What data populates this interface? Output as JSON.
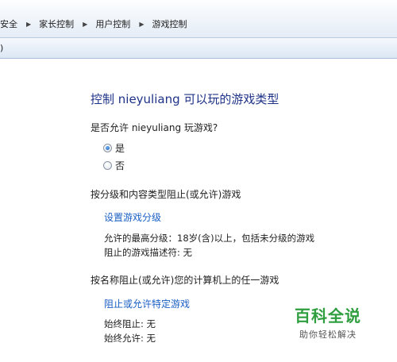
{
  "breadcrumb": {
    "items": [
      "安全",
      "家长控制",
      "用户控制",
      "游戏控制"
    ],
    "separator_icon": "triangle-right"
  },
  "menu": {
    "fragment": ")"
  },
  "main": {
    "title": "控制 nieyuliang 可以玩的游戏类型",
    "allow_question": "是否允许 nieyuliang 玩游戏?",
    "options": [
      {
        "label": "是",
        "checked": true
      },
      {
        "label": "否",
        "checked": false
      }
    ],
    "rating_section": {
      "heading": "按分级和内容类型阻止(或允许)游戏",
      "link": "设置游戏分级",
      "allowed_rating": "允许的最高分级：18岁(含)以上，包括未分级的游戏",
      "blocked_descriptors": "阻止的游戏描述符: 无"
    },
    "name_section": {
      "heading": "按名称阻止(或允许)您的计算机上的任一游戏",
      "link": "阻止或允许特定游戏",
      "always_block": "始终阻止: 无",
      "always_allow": "始终允许: 无"
    }
  },
  "watermark": {
    "title": "百科全说",
    "subtitle": "助你轻松解决"
  },
  "colors": {
    "title": "#1e3287",
    "link": "#1a5fc4",
    "watermark_green": "#2e9e3e"
  }
}
